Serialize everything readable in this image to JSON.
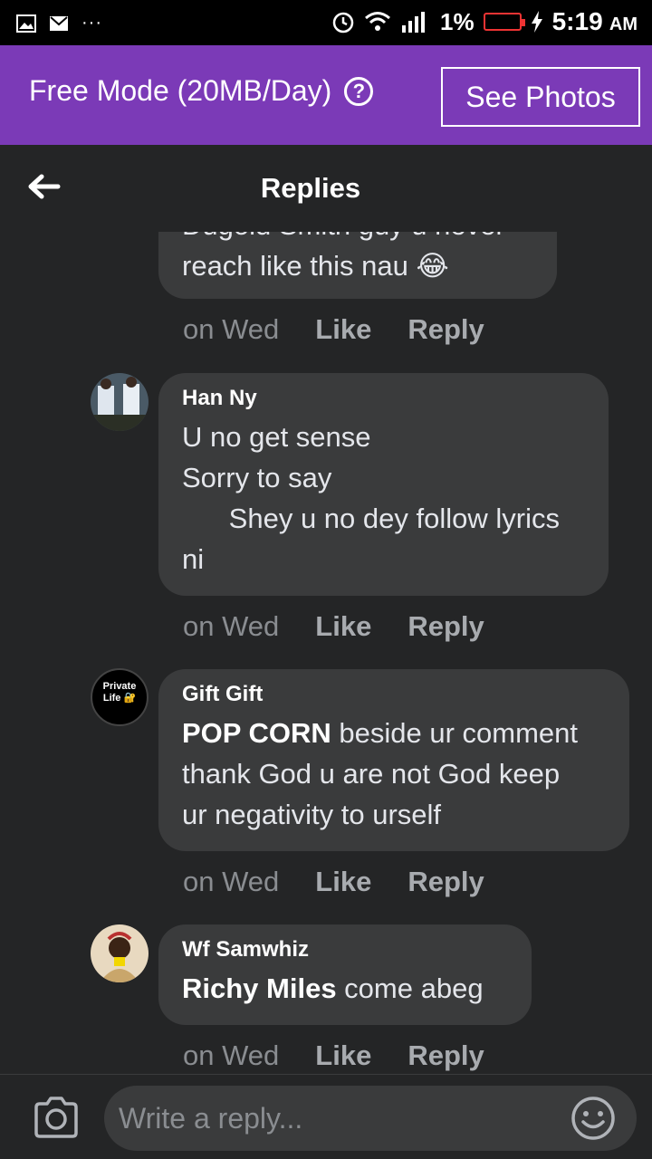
{
  "status_bar": {
    "battery": "1%",
    "time": "5:19",
    "ampm": "AM",
    "icons": [
      "gallery-icon",
      "mail-icon",
      "more-icon",
      "alarm-icon",
      "wifi-icon",
      "signal-icon",
      "battery-icon",
      "charging-icon"
    ]
  },
  "free_mode": {
    "text": "Free Mode (20MB/Day)",
    "button": "See Photos"
  },
  "header": {
    "title": "Replies"
  },
  "comments": [
    {
      "author": "",
      "lines": [
        "Dugold Smith guy u never",
        "reach like this nau 😂"
      ],
      "time": "on Wed",
      "like": "Like",
      "reply": "Reply"
    },
    {
      "author": "Han Ny",
      "lines": [
        "U no get sense",
        "Sorry to say",
        "      Shey u no dey follow lyrics",
        "ni"
      ],
      "time": "on Wed",
      "like": "Like",
      "reply": "Reply"
    },
    {
      "author": "Gift Gift",
      "tag": "POP CORN",
      "lines": [
        " beside ur comment",
        "thank God u are not God keep",
        "ur negativity to urself"
      ],
      "time": "on Wed",
      "like": "Like",
      "reply": "Reply",
      "avatar_text": "Private Life 🔐"
    },
    {
      "author": "Wf Samwhiz",
      "tag": "Richy Miles",
      "lines": [
        " come abeg"
      ],
      "time": "on Wed",
      "like": "Like",
      "reply": "Reply"
    }
  ],
  "composer": {
    "placeholder": "Write a reply..."
  }
}
